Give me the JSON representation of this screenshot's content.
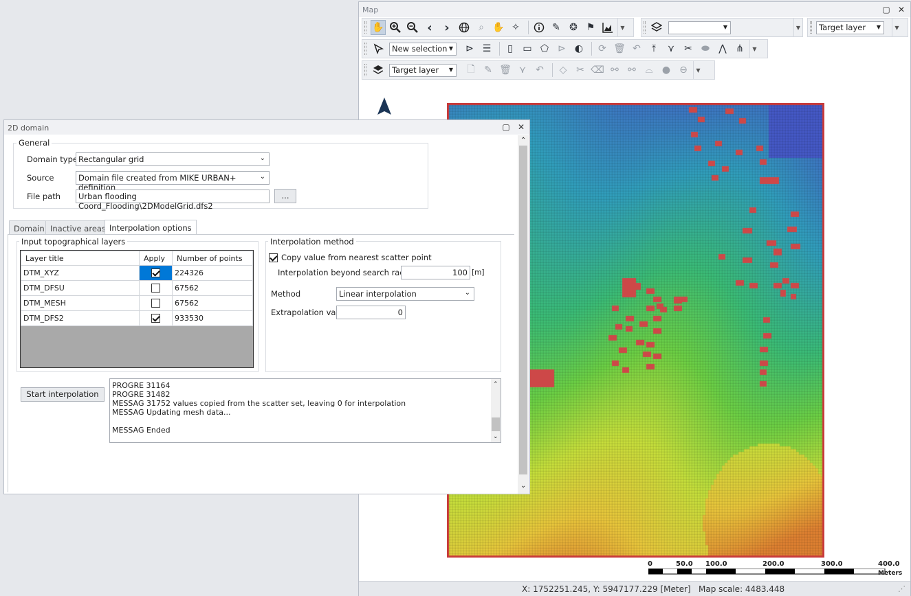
{
  "map": {
    "title": "Map",
    "toolbar1": {
      "layer_combo_value": "",
      "target_layer": "Target layer"
    },
    "toolbar2": {
      "selection_mode": "New selection"
    },
    "toolbar3": {
      "target_layer": "Target layer"
    },
    "scale_labels": [
      "0",
      "50.0",
      "100.0",
      "200.0",
      "300.0",
      "400.0"
    ],
    "scale_unit": "Meters",
    "status_text": "X: 1752251.245, Y: 5947177.229 [Meter]   Map scale: 4483.448"
  },
  "dialog": {
    "title": "2D domain",
    "general": {
      "label": "General",
      "domain_type_label": "Domain type",
      "domain_type_value": "Rectangular grid",
      "source_label": "Source",
      "source_value": "Domain file created from MIKE URBAN+ definition",
      "file_path_label": "File path",
      "file_path_value": "Urban flooding Coord_Flooding\\2DModelGrid.dfs2",
      "browse_label": "..."
    },
    "tabs": [
      "Domain",
      "Inactive areas",
      "Interpolation options"
    ],
    "input_layers": {
      "label": "Input topographical layers",
      "columns": [
        "Layer title",
        "Apply",
        "Number of points"
      ],
      "rows": [
        {
          "title": "DTM_XYZ",
          "apply": true,
          "points": "224326"
        },
        {
          "title": "DTM_DFSU",
          "apply": false,
          "points": "67562"
        },
        {
          "title": "DTM_MESH",
          "apply": false,
          "points": "67562"
        },
        {
          "title": "DTM_DFS2",
          "apply": true,
          "points": "933530"
        }
      ]
    },
    "method": {
      "label": "Interpolation method",
      "copy_nearest_label": "Copy value from nearest scatter point",
      "copy_nearest_checked": true,
      "beyond_radius_label": "Interpolation beyond search radius",
      "beyond_radius_value": "100",
      "beyond_radius_unit": "[m]",
      "method_label": "Method",
      "method_value": "Linear interpolation",
      "extrapolation_label": "Extrapolation value",
      "extrapolation_value": "0"
    },
    "start_button": "Start interpolation",
    "log_lines": [
      "PROGRE 31164",
      "PROGRE 31482",
      "MESSAG 31752 values copied from the scatter set, leaving 0 for interpolation",
      "MESSAG Updating mesh data...",
      "",
      "MESSAG Ended"
    ]
  }
}
